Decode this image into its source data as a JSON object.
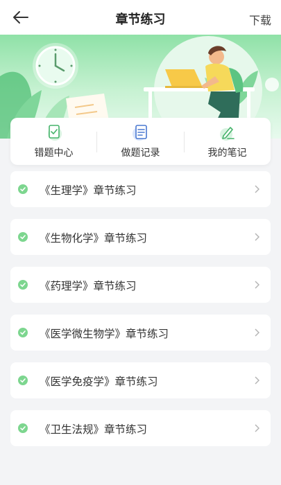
{
  "header": {
    "title": "章节练习",
    "action_label": "下载"
  },
  "quick_actions": [
    {
      "label": "错题中心",
      "icon": "clipboard-check-icon"
    },
    {
      "label": "做题记录",
      "icon": "document-list-icon"
    },
    {
      "label": "我的笔记",
      "icon": "pen-note-icon"
    }
  ],
  "chapters": [
    {
      "label": "《生理学》章节练习"
    },
    {
      "label": "《生物化学》章节练习"
    },
    {
      "label": "《药理学》章节练习"
    },
    {
      "label": "《医学微生物学》章节练习"
    },
    {
      "label": "《医学免疫学》章节练习"
    },
    {
      "label": "《卫生法规》章节练习"
    }
  ],
  "colors": {
    "accent": "#55c37a",
    "banner_top": "#8fe1a7",
    "banner_bottom": "#e8faee",
    "background": "#f3f4f6"
  }
}
